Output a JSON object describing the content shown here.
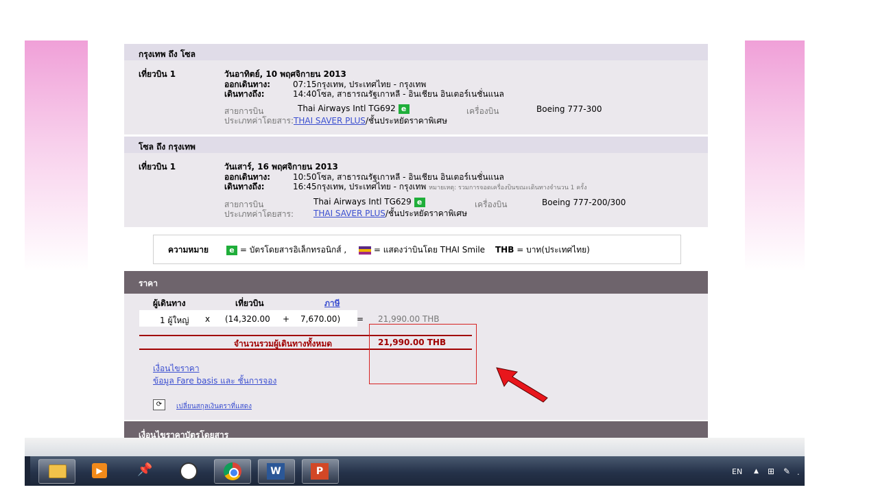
{
  "outbound": {
    "route_title": "กรุงเทพ ถึง โซล",
    "flight_label": "เที่ยวบิน 1",
    "date": "วันอาทิตย์, 10 พฤศจิกายน 2013",
    "depart_label": "ออกเดินทาง:",
    "depart_value": "07:15กรุงเทพ, ประเทศไทย - กรุงเทพ",
    "arrive_label": "เดินทางถึง:",
    "arrive_value": "14:40โซล, สาธารณรัฐเกาหลี - อินเชียน อินเตอร์เนชั่นแนล",
    "airline_label": "สายการบิน",
    "airline_value": "Thai Airways Intl TG692",
    "aircraft_label": "เครื่องบิน",
    "aircraft_value": "Boeing 777-300",
    "fare_type_label": "ประเภทค่าโดยสาร:",
    "fare_type_link": "THAI SAVER PLUS",
    "fare_type_suffix": "/ชั้นประหยัดราคาพิเศษ"
  },
  "inbound": {
    "route_title": "โซล ถึง กรุงเทพ",
    "flight_label": "เที่ยวบิน 1",
    "date": "วันเสาร์, 16 พฤศจิกายน 2013",
    "depart_label": "ออกเดินทาง:",
    "depart_value": "10:50โซล, สาธารณรัฐเกาหลี - อินเชียน อินเตอร์เนชั่นแนล",
    "arrive_label": "เดินทางถึง:",
    "arrive_value": "16:45กรุงเทพ, ประเทศไทย - กรุงเทพ",
    "arrive_note": "หมายเหตุ: รวมการจอดเครื่องบินขณะเดินทางจำนวน 1 ครั้ง",
    "airline_label": "สายการบิน",
    "airline_value": "Thai Airways Intl TG629",
    "aircraft_label": "เครื่องบิน",
    "aircraft_value": "Boeing 777-200/300",
    "fare_type_label": "ประเภทค่าโดยสาร:",
    "fare_type_link": "THAI SAVER PLUS",
    "fare_type_suffix": "/ชั้นประหยัดราคาพิเศษ"
  },
  "e_badge": "e",
  "legend": {
    "title": "ความหมาย",
    "eticket_text": "= บัตรโดยสารอิเล็กทรอนิกส์ ,",
    "smile_text": "= แสดงว่าบินโดย THAI Smile",
    "thb_code": "THB",
    "thb_text": "= บาท(ประเทศไทย)"
  },
  "price": {
    "section_title": "ราคา",
    "col_passenger": "ผู้เดินทาง",
    "col_flight": "เที่ยวบิน",
    "col_tax": "ภาษี",
    "count": "1 ผู้ใหญ่",
    "times": "x",
    "base_fare": "(14,320.00",
    "plus": "+",
    "tax": "7,670.00)",
    "equals": "=",
    "subtotal": "21,990.00 THB",
    "total_label": "จำนวนรวมผู้เดินทางทั้งหมด",
    "total_value": "21,990.00 THB",
    "link_conditions": "เงื่อนไขราคา",
    "link_fare_basis": "ข้อมูล Fare basis และ ชั้นการจอง",
    "change_currency": "เปลี่ยนสกุลเงินตราที่แสดง"
  },
  "next_section_title": "เงื่อนไขราคาบัตรโดยสาร",
  "taskbar": {
    "language": "EN",
    "word_label": "W",
    "ppt_label": "P"
  },
  "colors": {
    "band": "#e0dce8",
    "section": "#ebe8ed",
    "dark_bar": "#6e646c",
    "total_red": "#a00000",
    "link": "#3a4ed0",
    "eticket_green": "#1fae3a",
    "arrow_red": "#e8161c"
  }
}
